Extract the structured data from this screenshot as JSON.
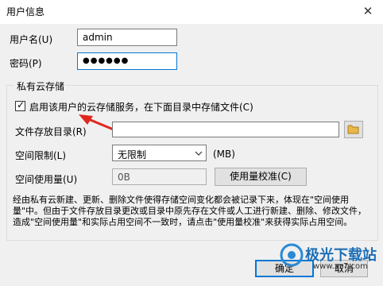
{
  "window": {
    "title": "用户信息",
    "close_glyph": "✕"
  },
  "username": {
    "label": "用户名(U)",
    "value": "admin"
  },
  "password": {
    "label": "密码(P)",
    "value": "●●●●●●"
  },
  "group": {
    "title": "私有云存储"
  },
  "enable_checkbox": {
    "label": "启用该用户的云存储服务，在下面目录中存储文件(C)",
    "checked": true,
    "glyph": "✓"
  },
  "directory": {
    "label": "文件存放目录(R)",
    "value": "",
    "browse_icon": "folder-icon"
  },
  "quota": {
    "label": "空间限制(L)",
    "value": "无限制",
    "unit": "(MB)"
  },
  "usage": {
    "label": "空间使用量(U)",
    "value": "0B",
    "button": "使用量校准(C)"
  },
  "description": "经由私有云新建、更新、删除文件使得存储空间变化都会被记录下来，体现在\"空间使用量\"中。但由于文件存放目录更改或目录中原先存在文件或人工进行新建、删除、修改文件，造成\"空间使用量\"和实际占用空间不一致时，请点击\"使用量校准\"来获得实际占用空间。",
  "buttons": {
    "ok": "确定",
    "cancel": "取消"
  },
  "watermark": {
    "line1": "极光下载站",
    "line2": "www.xz7.com"
  },
  "colors": {
    "accent": "#0078d7",
    "arrow": "#e0281e",
    "folder": "#e8b84a"
  }
}
